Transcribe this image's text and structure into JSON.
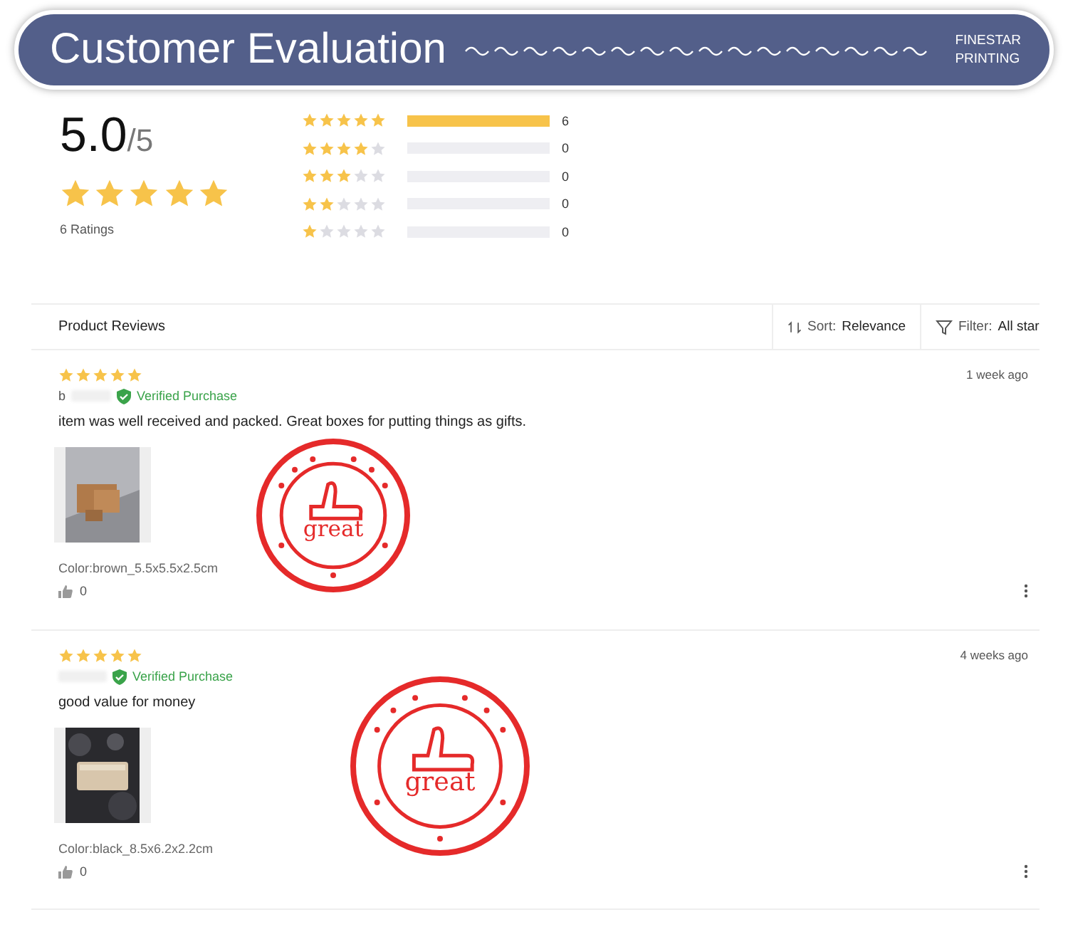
{
  "banner": {
    "title": "Customer Evaluation",
    "brand_lines": [
      "FINESTAR",
      "PRINTING"
    ]
  },
  "summary": {
    "score": "5.0",
    "out_of": "/5",
    "stars": 5,
    "ratings": "6 Ratings"
  },
  "histogram": [
    {
      "stars": 5,
      "level": 1,
      "count": "6"
    },
    {
      "stars": 4,
      "level": 0,
      "count": "0"
    },
    {
      "stars": 3,
      "level": 0,
      "count": "0"
    },
    {
      "stars": 2,
      "level": 0,
      "count": "0"
    },
    {
      "stars": 1,
      "level": 0,
      "count": "0"
    }
  ],
  "reviews_header": {
    "title": "Product Reviews",
    "sort_label": "Sort:",
    "sort_value": "Relevance",
    "filter_label": "Filter:",
    "filter_value": "All star"
  },
  "reviews": [
    {
      "stars": 5,
      "reviewer": "b",
      "verified": "Verified Purchase",
      "time": "1 week ago",
      "text": "item was well received and packed. Great boxes for putting things as gifts.",
      "variant": "Color:brown_5.5x5.5x2.5cm",
      "likes": "0",
      "stamp": "great"
    },
    {
      "stars": 5,
      "verified": "Verified Purchase",
      "time": "4 weeks ago",
      "text": "good value for money",
      "variant": "Color:black_8.5x6.2x2.2cm",
      "likes": "0",
      "stamp": "great"
    }
  ]
}
